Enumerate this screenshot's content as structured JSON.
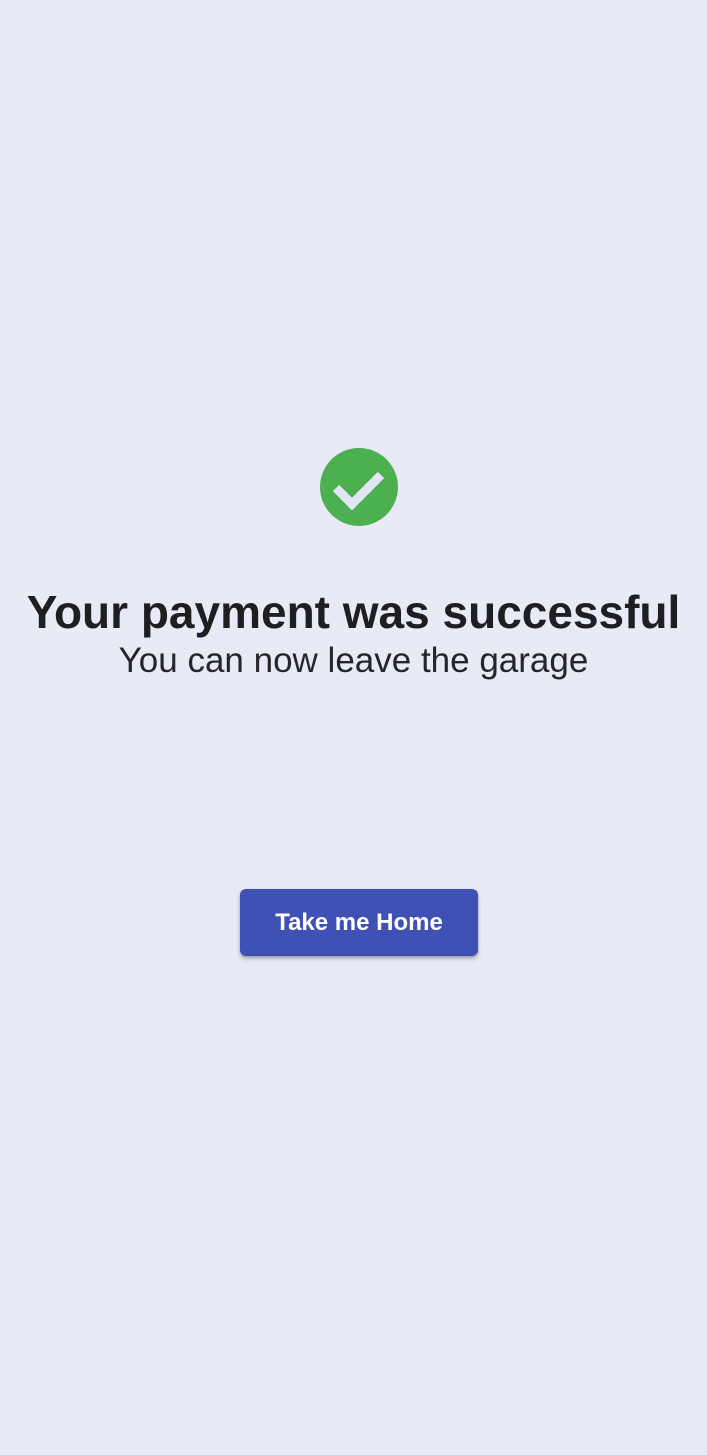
{
  "status": {
    "icon": "check-circle-icon",
    "title": "Your payment was successful",
    "message": "You can now leave the garage"
  },
  "actions": {
    "home_label": "Take me Home"
  },
  "colors": {
    "background": "#e8eaf6",
    "success": "#4caf50",
    "primary": "#3f51b5",
    "text": "#1f1f22"
  }
}
